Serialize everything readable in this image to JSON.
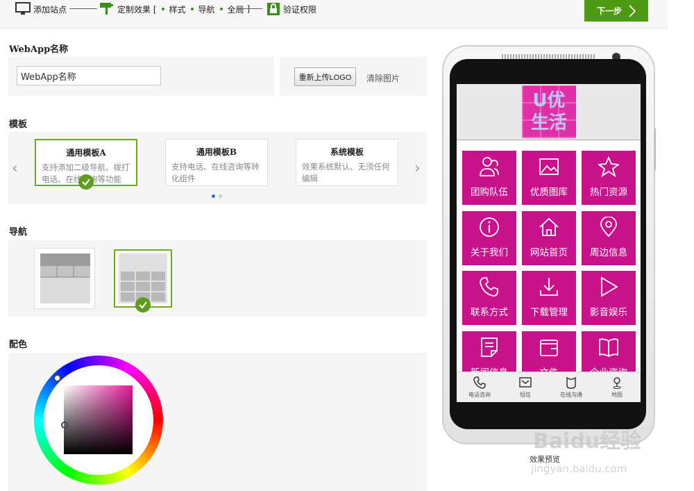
{
  "topbar": {
    "step1": "添加站点",
    "step2": "定制效果 [",
    "step2_sub1": "样式",
    "step2_sub2": "导航",
    "step2_sub3": "全局",
    "step2_end": "]",
    "step3": "验证权限",
    "next_label": "下一步"
  },
  "name_section": {
    "title": "WebApp名称",
    "input_value": "WebApp名称",
    "upload_label": "重新上传LOGO",
    "clear_label": "清除图片"
  },
  "template_section": {
    "title": "模板",
    "templates": [
      {
        "title": "通用模板A",
        "desc": "支持添加二级导航、拨打电话、在线咨询等功能"
      },
      {
        "title": "通用模板B",
        "desc": "支持电话、在线咨询等转化组件"
      },
      {
        "title": "系统模板",
        "desc": "效果系统默认、无须任何编辑"
      }
    ],
    "prev_arrow": "‹",
    "next_arrow": "›"
  },
  "nav_section": {
    "title": "导航"
  },
  "color_section": {
    "title": "配色"
  },
  "preview": {
    "caption": "效果预览",
    "logo_text": "U优生活",
    "tiles": [
      {
        "label": "团购队伍",
        "icon": "users-icon"
      },
      {
        "label": "优质图库",
        "icon": "image-icon"
      },
      {
        "label": "热门资源",
        "icon": "star-icon"
      },
      {
        "label": "关于我们",
        "icon": "info-icon"
      },
      {
        "label": "网站首页",
        "icon": "home-icon"
      },
      {
        "label": "周边信息",
        "icon": "map-pin-icon"
      },
      {
        "label": "联系方式",
        "icon": "phone-icon"
      },
      {
        "label": "下载管理",
        "icon": "download-icon"
      },
      {
        "label": "影音娱乐",
        "icon": "play-icon"
      },
      {
        "label": "新闻信息",
        "icon": "document-icon"
      },
      {
        "label": "文件",
        "icon": "wallet-icon"
      },
      {
        "label": "企业资询",
        "icon": "book-icon"
      }
    ],
    "bottom_nav": [
      {
        "label": "电话咨询",
        "icon": "phone-icon"
      },
      {
        "label": "短信",
        "icon": "mail-icon"
      },
      {
        "label": "在线沟通",
        "icon": "chat-icon"
      },
      {
        "label": "地图",
        "icon": "location-icon"
      }
    ],
    "accent": "#c8128c"
  },
  "watermark": {
    "line1": "Baidu经验",
    "line2": "jingyan.baidu.com"
  },
  "colors": {
    "green": "#4e9a12",
    "magenta": "#c8128c"
  }
}
